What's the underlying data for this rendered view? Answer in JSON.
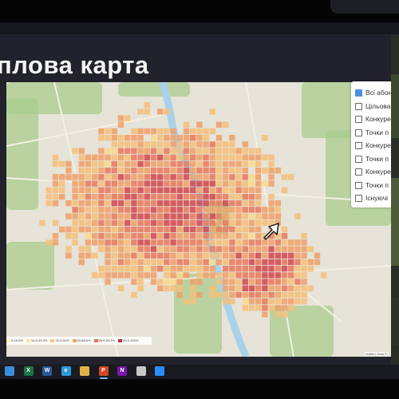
{
  "slide": {
    "title": "плова карта"
  },
  "map": {
    "legend_items": [
      {
        "label": "0-16.6%",
        "color": "#fff7c2"
      },
      {
        "label": "16.6-33.3%",
        "color": "#fde7a0"
      },
      {
        "label": "33.3-50%",
        "color": "#f9c97a"
      },
      {
        "label": "50-66.6%",
        "color": "#f2a167"
      },
      {
        "label": "66.6-83.3%",
        "color": "#e8705a"
      },
      {
        "label": "83.3-100%",
        "color": "#c0304a"
      }
    ],
    "attribution": "Leaflet | Data ©",
    "heat_colors": [
      "#fdeea0",
      "#f9d98a",
      "#f5bf7a",
      "#f0a06a",
      "#e97a5e",
      "#d24a4e"
    ],
    "background_color": "#e6e3d8",
    "park_color": "#a9cc8e",
    "water_color": "#a8d2ea"
  },
  "layer_panel": {
    "items": [
      {
        "label": "Всі абонен",
        "checked": true
      },
      {
        "label": "Цільова",
        "checked": false
      },
      {
        "label": "Конкуре",
        "checked": false
      },
      {
        "label": "Точки п",
        "checked": false
      },
      {
        "label": "Конкуре",
        "checked": false
      },
      {
        "label": "Точки п",
        "checked": false
      },
      {
        "label": "Конкуре",
        "checked": false
      },
      {
        "label": "Точки п",
        "checked": false
      },
      {
        "label": "Існуючі",
        "checked": false
      }
    ]
  },
  "taskbar": {
    "icons": [
      {
        "name": "chrome-icon",
        "color": "#3a8dde",
        "glyph": ""
      },
      {
        "name": "excel-icon",
        "color": "#1f7244",
        "glyph": "X"
      },
      {
        "name": "word-icon",
        "color": "#2b5797",
        "glyph": "W"
      },
      {
        "name": "edge-icon",
        "color": "#2d9ad8",
        "glyph": "e"
      },
      {
        "name": "explorer-icon",
        "color": "#e0b34a",
        "glyph": ""
      },
      {
        "name": "powerpoint-icon",
        "color": "#d24726",
        "glyph": "P"
      },
      {
        "name": "onenote-icon",
        "color": "#7719aa",
        "glyph": "N"
      },
      {
        "name": "photos-icon",
        "color": "#c8c8c8",
        "glyph": ""
      },
      {
        "name": "zoom-icon",
        "color": "#2d8cff",
        "glyph": ""
      }
    ]
  }
}
